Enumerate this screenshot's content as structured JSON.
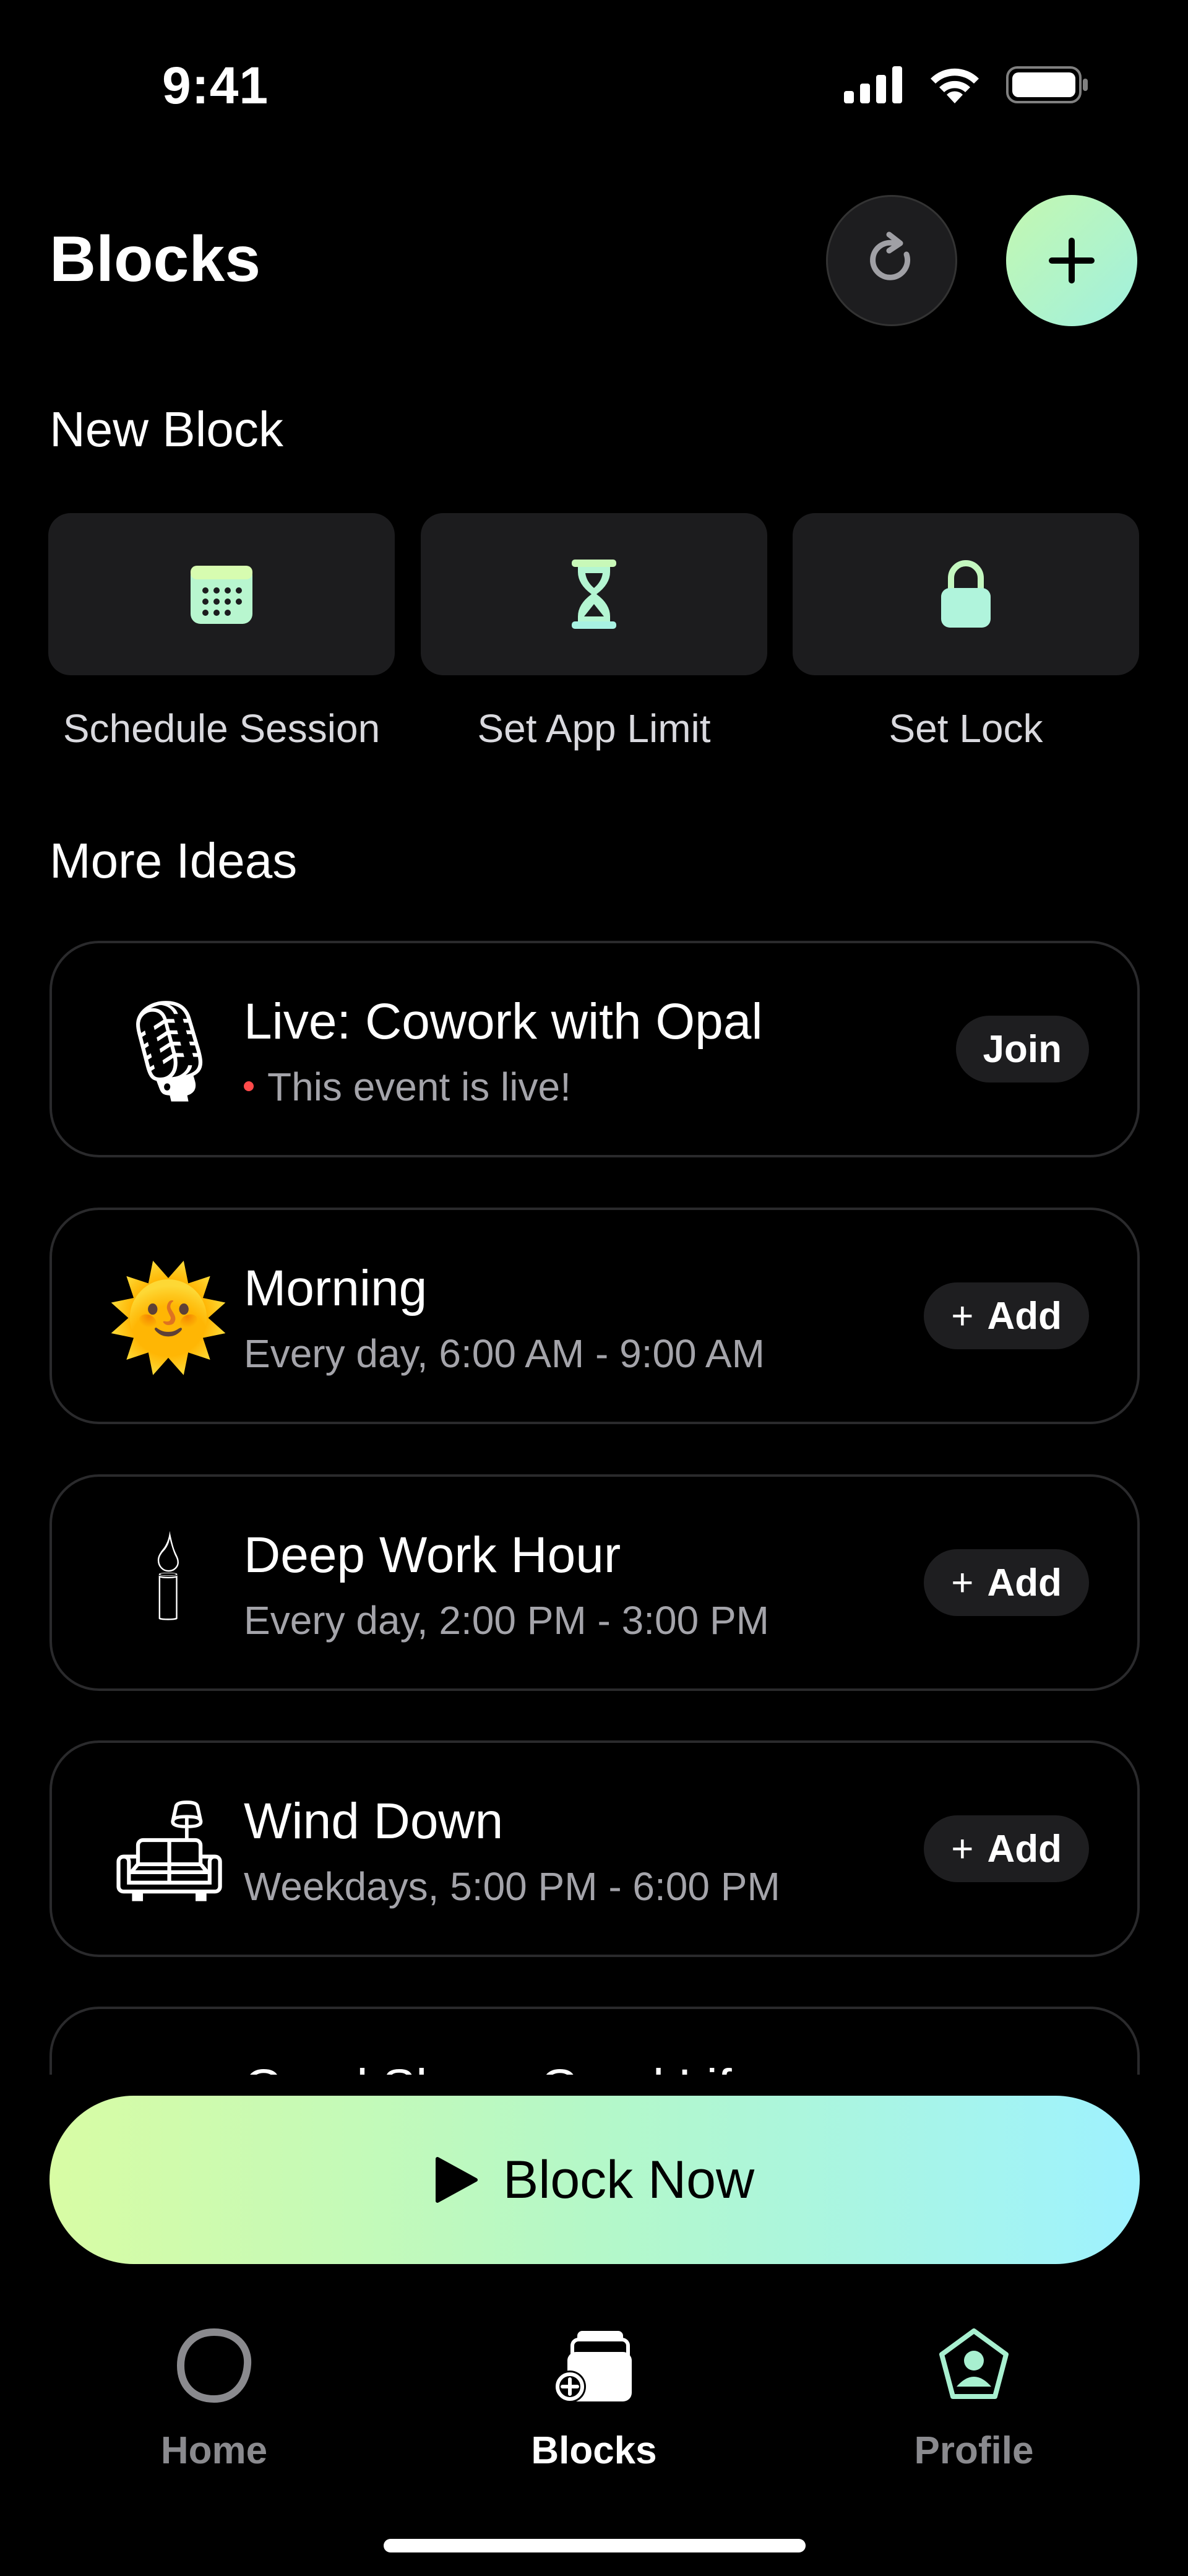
{
  "status_bar": {
    "time": "9:41"
  },
  "header": {
    "title": "Blocks"
  },
  "new_block": {
    "title": "New Block",
    "tiles": [
      {
        "label": "Schedule Session",
        "icon": "calendar-icon"
      },
      {
        "label": "Set App Limit",
        "icon": "hourglass-icon"
      },
      {
        "label": "Set Lock",
        "icon": "lock-icon"
      }
    ]
  },
  "more_ideas": {
    "title": "More Ideas",
    "cards": [
      {
        "emoji": "🎙",
        "title": "Live: Cowork with Opal",
        "subtitle": "This event is live!",
        "action": "Join",
        "live": true
      },
      {
        "emoji": "🌞",
        "title": "Morning",
        "subtitle": "Every day, 6:00 AM - 9:00 AM",
        "action": "Add"
      },
      {
        "emoji": "🕯",
        "title": "Deep Work Hour",
        "subtitle": "Every day, 2:00 PM - 3:00 PM",
        "action": "Add"
      },
      {
        "emoji": "🛋",
        "title": "Wind Down",
        "subtitle": "Weekdays, 5:00 PM - 6:00 PM",
        "action": "Add"
      }
    ],
    "partial_card_title": "Good Sleep, Good Life"
  },
  "cta": {
    "label": "Block Now"
  },
  "tab_bar": {
    "tabs": [
      {
        "label": "Home",
        "icon": "home-icon",
        "active": false
      },
      {
        "label": "Blocks",
        "icon": "blocks-icon",
        "active": true
      },
      {
        "label": "Profile",
        "icon": "profile-icon",
        "active": false
      }
    ]
  },
  "colors": {
    "accent_mint": "#a8f5c8",
    "accent_cyan": "#9ef2ff",
    "accent_lime": "#d8fca4",
    "live_red": "#ff4a4a",
    "inactive": "#8a8a8e"
  }
}
